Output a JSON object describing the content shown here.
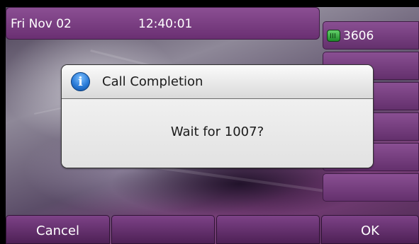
{
  "status_bar": {
    "date": "Fri Nov 02",
    "time": "12:40:01"
  },
  "line_keys": [
    {
      "label": "3606",
      "icon": "phone-line-icon"
    },
    {
      "label": ""
    },
    {
      "label": ""
    },
    {
      "label": ""
    },
    {
      "label": ""
    },
    {
      "label": ""
    }
  ],
  "dialog": {
    "title": "Call Completion",
    "icon": "info-icon",
    "message": "Wait for 1007?"
  },
  "softkeys": [
    "Cancel",
    "",
    "",
    "OK"
  ],
  "colors": {
    "accent": "#7a3f84",
    "dialog_bg": "#e9e9e9",
    "phone_icon": "#3fb84a"
  }
}
